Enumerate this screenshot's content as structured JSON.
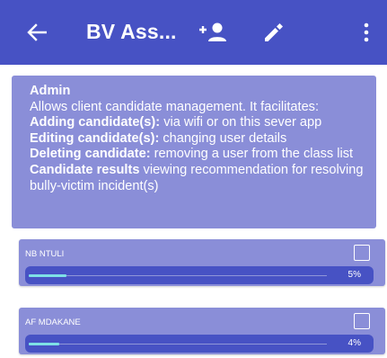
{
  "appbar": {
    "title": "BV Ass...",
    "back_icon": "arrow-left-icon",
    "add_icon": "person-add-icon",
    "edit_icon": "pencil-icon",
    "more_icon": "more-vertical-icon",
    "color": "#4752c4"
  },
  "info": {
    "heading": "Admin",
    "intro": "Allows client candidate management. It facilitates:",
    "lines": [
      {
        "bold": "Adding candidate(s):",
        "text": " via wifi or on this sever app"
      },
      {
        "bold": "Editing candidate(s):",
        "text": " changing user details"
      },
      {
        "bold": "Deleting candidate:",
        "text": " removing a user from the class list"
      },
      {
        "bold": "Candidate results",
        "text": " viewing recommendation for resolving bully-victim incident(s)"
      }
    ]
  },
  "candidates": [
    {
      "name": "NB NTULI",
      "progress": 5,
      "progress_label": "5%",
      "checked": false
    },
    {
      "name": "AF MDAKANE",
      "progress": 4,
      "progress_label": "4%",
      "checked": false
    }
  ],
  "colors": {
    "card": "#8a8ed8",
    "track": "#4752c4",
    "progress": "#7ee0e6"
  }
}
